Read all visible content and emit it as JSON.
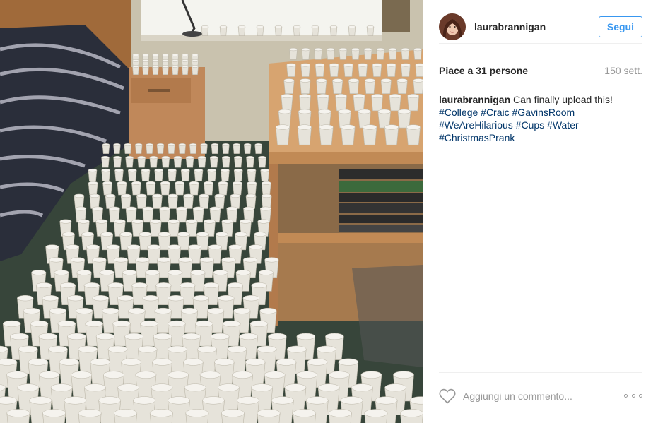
{
  "post": {
    "photo_alt": "",
    "author": {
      "username": "laurabrannigan",
      "avatar_icon": "profile-avatar"
    },
    "follow_label": "Segui",
    "likes_text": "Piace a 31 persone",
    "time_text": "150 sett.",
    "caption": {
      "user": "laurabrannigan",
      "text": "Can finally upload this!",
      "hashtags": [
        "#College",
        "#Craic",
        "#GavinsRoom",
        "#WeAreHilarious",
        "#Cups",
        "#Water",
        "#ChristmasPrank"
      ]
    },
    "comment_placeholder": "Aggiungi un commento...",
    "icons": {
      "like": "heart-icon",
      "more": "more-options-icon"
    }
  },
  "colors": {
    "accent": "#3897f0",
    "hashtag": "#003569",
    "muted": "#999999",
    "text": "#262626"
  }
}
